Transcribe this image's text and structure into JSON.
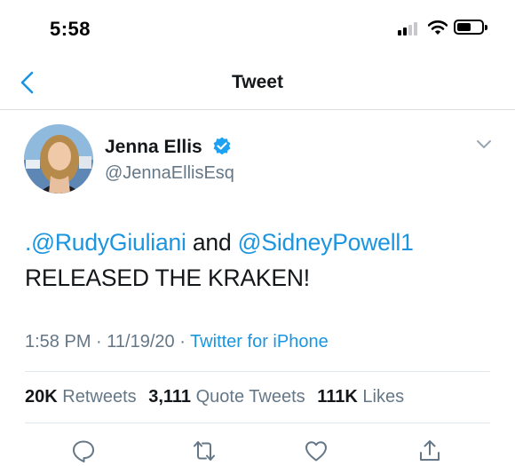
{
  "status_bar": {
    "time": "5:58",
    "icons": [
      "cellular-signal-icon",
      "wifi-icon",
      "battery-icon"
    ]
  },
  "nav": {
    "title": "Tweet",
    "back_icon": "chevron-left-icon"
  },
  "tweet": {
    "author": {
      "display_name": "Jenna Ellis",
      "handle": "@JennaEllisEsq",
      "verified": true
    },
    "text": {
      "prefix": ".",
      "mention1": "@RudyGiuliani",
      "joiner": " and ",
      "mention2": "@SidneyPowell1",
      "line2": "RELEASED THE KRAKEN!"
    },
    "meta": {
      "time": "1:58 PM",
      "separator": " · ",
      "date": "11/19/20",
      "source": "Twitter for iPhone"
    },
    "stats": {
      "retweets_count": "20K",
      "retweets_label": "Retweets",
      "quotes_count": "3,111",
      "quotes_label": "Quote Tweets",
      "likes_count": "111K",
      "likes_label": "Likes"
    },
    "actions": [
      "reply-icon",
      "retweet-icon",
      "like-icon",
      "share-icon"
    ]
  },
  "colors": {
    "accent": "#1b95e0",
    "text": "#14171a",
    "secondary": "#657786",
    "divider": "#e1e8ed"
  }
}
